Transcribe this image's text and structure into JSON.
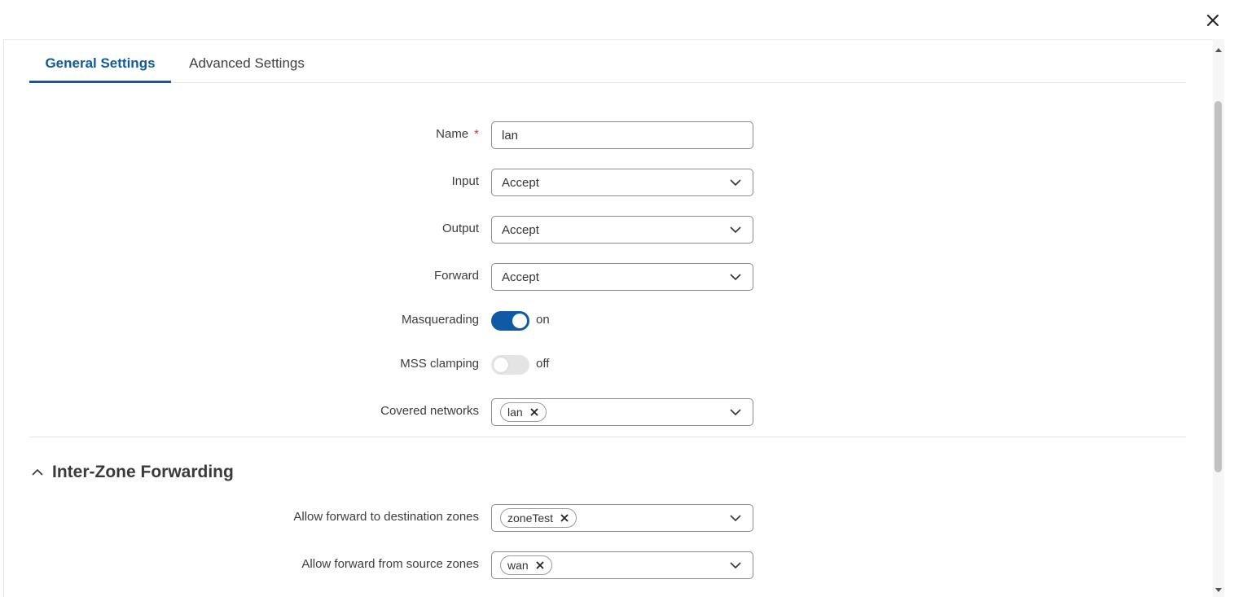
{
  "tabs": [
    {
      "label": "General Settings",
      "active": true
    },
    {
      "label": "Advanced Settings",
      "active": false
    }
  ],
  "form": {
    "name": {
      "label": "Name",
      "required_mark": "*",
      "value": "lan"
    },
    "input": {
      "label": "Input",
      "value": "Accept"
    },
    "output": {
      "label": "Output",
      "value": "Accept"
    },
    "forward": {
      "label": "Forward",
      "value": "Accept"
    },
    "masquerading": {
      "label": "Masquerading",
      "state": "on"
    },
    "mss_clamping": {
      "label": "MSS clamping",
      "state": "off"
    },
    "covered_networks": {
      "label": "Covered networks",
      "chips": [
        "lan"
      ]
    }
  },
  "inter_zone": {
    "title": "Inter-Zone Forwarding",
    "dest": {
      "label": "Allow forward to destination zones",
      "chips": [
        "zoneTest"
      ]
    },
    "src": {
      "label": "Allow forward from source zones",
      "chips": [
        "wan"
      ]
    }
  },
  "colors": {
    "accent": "#0f5aa3",
    "required": "#d9302a"
  },
  "icons": {
    "close": "close-icon",
    "chevron": "chevron-down-icon",
    "collapse": "chevron-up-icon",
    "remove": "remove-chip-icon"
  }
}
